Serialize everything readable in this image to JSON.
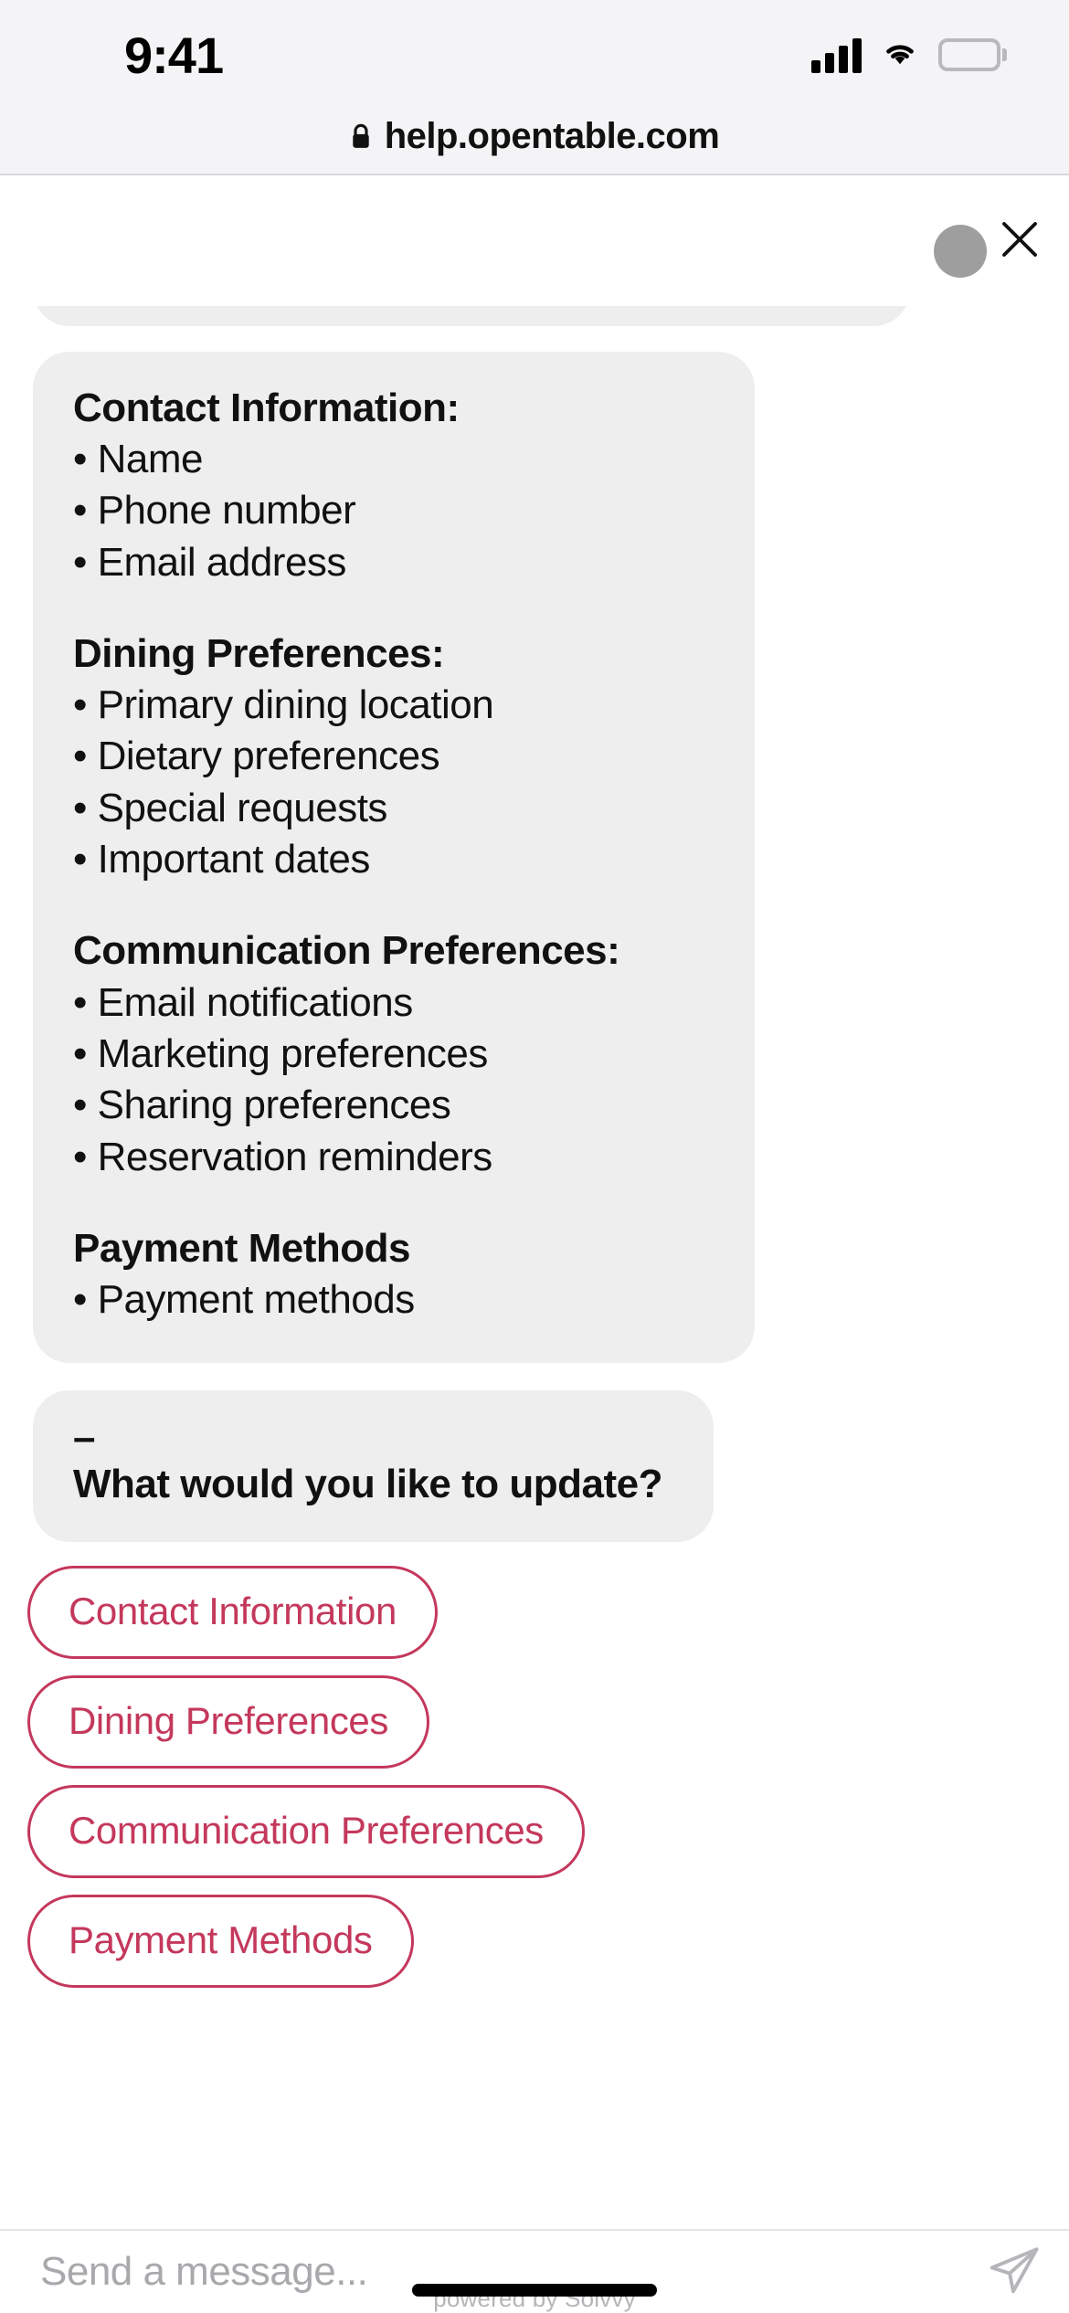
{
  "status_bar": {
    "time": "9:41",
    "cellular_icon": "cellular-bars-icon",
    "wifi_icon": "wifi-icon",
    "battery_icon": "battery-full-icon"
  },
  "browser": {
    "url": "help.opentable.com",
    "lock_icon": "lock-icon"
  },
  "widget_header": {
    "avatar": "agent-avatar",
    "close_icon": "close-icon"
  },
  "chat": {
    "clipped_bubble": {
      "dash": "–"
    },
    "info_bubble": {
      "sections": [
        {
          "heading": "Contact Information:",
          "items": [
            "• Name",
            "• Phone number",
            "• Email address"
          ]
        },
        {
          "heading": "Dining Preferences:",
          "items": [
            "• Primary dining location",
            "• Dietary preferences",
            "• Special requests",
            "• Important dates"
          ]
        },
        {
          "heading": "Communication Preferences:",
          "items": [
            "• Email notifications",
            "• Marketing preferences",
            "• Sharing preferences",
            "• Reservation reminders"
          ]
        },
        {
          "heading": "Payment Methods",
          "items": [
            "• Payment methods"
          ]
        }
      ]
    },
    "question_bubble": {
      "dash": "–",
      "text": "What would you like to update?"
    },
    "quick_replies": [
      {
        "label": "Contact Information"
      },
      {
        "label": "Dining Preferences"
      },
      {
        "label": "Communication Preferences"
      },
      {
        "label": "Payment Methods"
      }
    ]
  },
  "composer": {
    "placeholder": "Send a message...",
    "value": "",
    "send_icon": "send-paper-plane-icon"
  },
  "footer": {
    "powered_by": "powered by Solvvy"
  },
  "colors": {
    "accent": "#c4385c",
    "bubble_bg": "#eeeeef",
    "chrome_bg": "#f4f4f6"
  }
}
